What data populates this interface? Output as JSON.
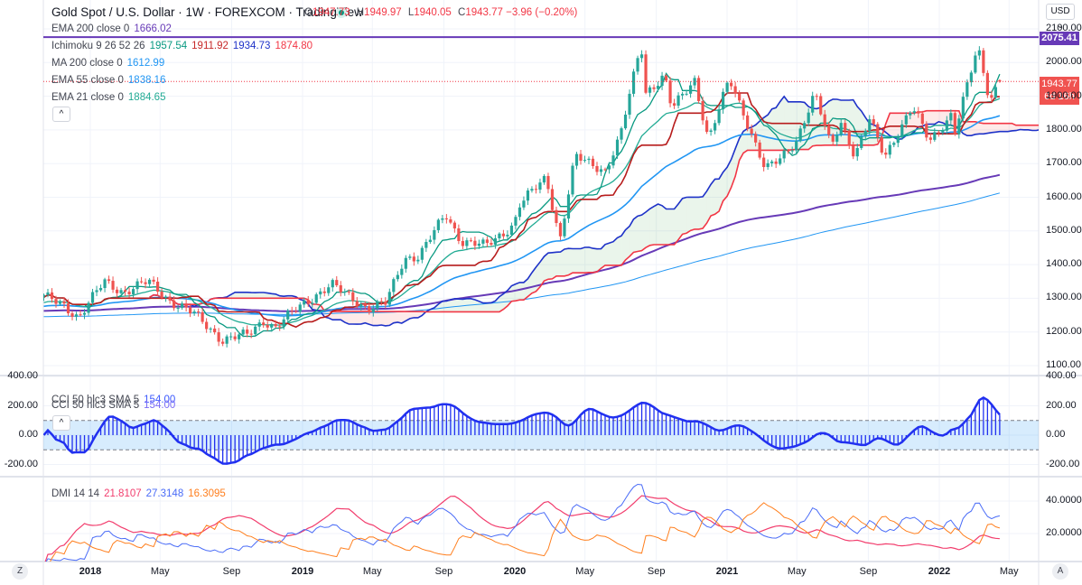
{
  "header": {
    "title": "Gold Spot / U.S. Dollar · 1W · FOREXCOM · TradingView",
    "status_icon": "market-open-dot",
    "open_key": "O",
    "open": "1947.73",
    "high_key": "H",
    "high": "1949.97",
    "low_key": "L",
    "low": "1940.05",
    "close_key": "C",
    "close": "1943.77",
    "change": "−3.96 (−0.20%)",
    "currency": "USD"
  },
  "legend": {
    "ema200": {
      "label": "EMA 200 close 0",
      "value": "1666.02",
      "color": "#673ab7"
    },
    "ichimoku": {
      "label": "Ichimoku 9 26 52 26",
      "v1": "1957.54",
      "v2": "1911.92",
      "v3": "1934.73",
      "v4": "1874.80"
    },
    "ma200": {
      "label": "MA 200 close 0",
      "value": "1612.99",
      "color": "#2196f3"
    },
    "ema55": {
      "label": "EMA 55 close 0",
      "value": "1838.16",
      "color": "#2196f3"
    },
    "ema21": {
      "label": "EMA 21 close 0",
      "value": "1884.65",
      "color": "#22ab94"
    },
    "collapse": "^"
  },
  "cci_legend": [
    {
      "label": "CCI 50 hlc3 SMA 5",
      "value": "154.00"
    },
    {
      "label": "CCI 50 hlc3 SMA 5",
      "value": "154.00"
    }
  ],
  "dmi_legend": {
    "label": "DMI 14 14",
    "adx": "21.8107",
    "plus_di": "27.3148",
    "minus_di": "16.3095"
  },
  "price_labels": {
    "resistance": "2075.41",
    "last": "1943.77",
    "countdown": "6d 16h"
  },
  "bottom": {
    "left_button": "Z",
    "right_button": "A"
  },
  "chart_data": {
    "type": "candlestick",
    "symbol": "XAUUSD",
    "interval": "1W",
    "colors": {
      "up": "#26a69a",
      "down": "#ef5350",
      "ema200": "#673ab7",
      "ma200": "#2196f3",
      "ema55": "#2196f3",
      "ema21": "#22ab94",
      "conversion": "#089981",
      "base": "#b71c1c",
      "lead_a": "#1e32c8",
      "lead_b": "#f23645",
      "resistance": "#673ab7",
      "cci": "#2130f0",
      "adx": "#f23d6d",
      "plus_di": "#4a6cf7",
      "minus_di": "#ff7f1e"
    },
    "last_candle": {
      "open": 1947.73,
      "high": 1949.97,
      "low": 1940.05,
      "close": 1943.77
    },
    "resistance_level": 2075.41,
    "close_path": [
      [
        "2017-10-13",
        1304
      ],
      [
        "2017-11-15",
        1282
      ],
      [
        "2017-12-12",
        1243
      ],
      [
        "2018-01-25",
        1350
      ],
      [
        "2018-02-28",
        1318
      ],
      [
        "2018-04-11",
        1350
      ],
      [
        "2018-05-20",
        1290
      ],
      [
        "2018-06-30",
        1252
      ],
      [
        "2018-08-16",
        1176
      ],
      [
        "2018-09-28",
        1192
      ],
      [
        "2018-10-26",
        1235
      ],
      [
        "2018-11-15",
        1212
      ],
      [
        "2018-12-31",
        1282
      ],
      [
        "2019-02-20",
        1340
      ],
      [
        "2019-04-23",
        1270
      ],
      [
        "2019-05-24",
        1285
      ],
      [
        "2019-06-25",
        1420
      ],
      [
        "2019-07-20",
        1425
      ],
      [
        "2019-09-04",
        1550
      ],
      [
        "2019-10-01",
        1470
      ],
      [
        "2019-11-12",
        1455
      ],
      [
        "2019-12-31",
        1520
      ],
      [
        "2020-01-08",
        1575
      ],
      [
        "2020-02-24",
        1660
      ],
      [
        "2020-03-19",
        1475
      ],
      [
        "2020-04-14",
        1720
      ],
      [
        "2020-06-05",
        1680
      ],
      [
        "2020-07-01",
        1780
      ],
      [
        "2020-08-06",
        2060
      ],
      [
        "2020-08-12",
        1910
      ],
      [
        "2020-09-15",
        1960
      ],
      [
        "2020-09-28",
        1860
      ],
      [
        "2020-11-06",
        1950
      ],
      [
        "2020-11-30",
        1770
      ],
      [
        "2021-01-05",
        1950
      ],
      [
        "2021-02-01",
        1840
      ],
      [
        "2021-03-08",
        1680
      ],
      [
        "2021-03-31",
        1710
      ],
      [
        "2021-04-30",
        1770
      ],
      [
        "2021-06-01",
        1905
      ],
      [
        "2021-06-29",
        1750
      ],
      [
        "2021-07-15",
        1830
      ],
      [
        "2021-08-09",
        1720
      ],
      [
        "2021-09-03",
        1830
      ],
      [
        "2021-09-29",
        1725
      ],
      [
        "2021-11-16",
        1865
      ],
      [
        "2021-12-15",
        1770
      ],
      [
        "2022-01-25",
        1850
      ],
      [
        "2022-01-28",
        1790
      ],
      [
        "2022-03-08",
        2050
      ],
      [
        "2022-03-29",
        1890
      ],
      [
        "2022-04-15",
        1943.77
      ]
    ],
    "price_axis": {
      "range": [
        1100,
        2100
      ],
      "ticks": [
        {
          "v": 2100,
          "label": "2100.00"
        },
        {
          "v": 2000,
          "label": "2000.00"
        },
        {
          "v": 1900,
          "label": "1900.00"
        },
        {
          "v": 1800,
          "label": "1800.00"
        },
        {
          "v": 1700,
          "label": "1700.00"
        },
        {
          "v": 1600,
          "label": "1600.00"
        },
        {
          "v": 1500,
          "label": "1500.00"
        },
        {
          "v": 1400,
          "label": "1400.00"
        },
        {
          "v": 1300,
          "label": "1300.00"
        },
        {
          "v": 1200,
          "label": "1200.00"
        },
        {
          "v": 1100,
          "label": "1100.00"
        }
      ]
    },
    "cci_axis": {
      "band": [
        -100,
        100
      ],
      "ticks": [
        {
          "v": 400,
          "label": "400.00"
        },
        {
          "v": 200,
          "label": "200.00"
        },
        {
          "v": 0,
          "label": "0.00"
        },
        {
          "v": -200,
          "label": "-200.00"
        }
      ]
    },
    "dmi_axis": {
      "ticks": [
        {
          "v": 40,
          "label": "40.0000"
        },
        {
          "v": 20,
          "label": "20.0000"
        }
      ]
    },
    "time_axis": [
      {
        "label": "2018",
        "date": "2018-01-01",
        "bold": true
      },
      {
        "label": "May",
        "date": "2018-05-01"
      },
      {
        "label": "Sep",
        "date": "2018-09-01"
      },
      {
        "label": "2019",
        "date": "2019-01-01",
        "bold": true
      },
      {
        "label": "May",
        "date": "2019-05-01"
      },
      {
        "label": "Sep",
        "date": "2019-09-01"
      },
      {
        "label": "2020",
        "date": "2020-01-01",
        "bold": true
      },
      {
        "label": "May",
        "date": "2020-05-01"
      },
      {
        "label": "Sep",
        "date": "2020-09-01"
      },
      {
        "label": "2021",
        "date": "2021-01-01",
        "bold": true
      },
      {
        "label": "May",
        "date": "2021-05-01"
      },
      {
        "label": "Sep",
        "date": "2021-09-01"
      },
      {
        "label": "2022",
        "date": "2022-01-01",
        "bold": true
      },
      {
        "label": "May",
        "date": "2022-05-01"
      }
    ],
    "grid": true
  }
}
